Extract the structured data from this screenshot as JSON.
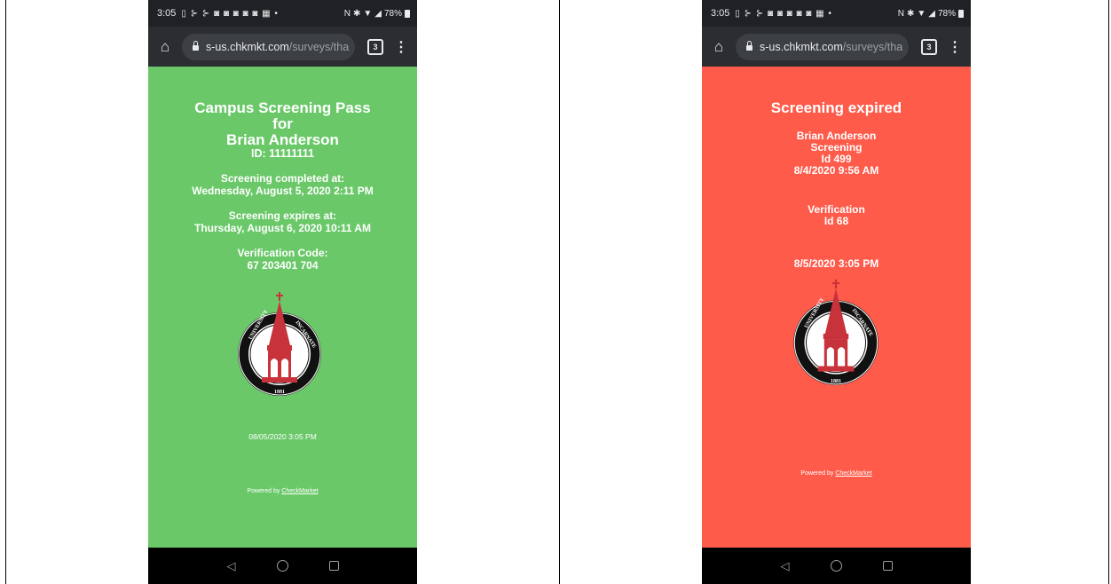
{
  "screens": [
    {
      "status_bar": {
        "time": "3:05",
        "notifications": "▯ ⊱ ⊱ ◙ ◙ ◙ ◙ ◙ ▦ •",
        "nfc": "N",
        "bluetooth": "✱",
        "battery": "78%"
      },
      "browser": {
        "url_domain": "s-us.chkmkt.com",
        "url_path": "/surveys/tha",
        "tab_count": "3"
      },
      "title_line1": "Campus Screening Pass",
      "title_line2": "for",
      "title_line3": "Brian Anderson",
      "id_line": "ID: 11111111",
      "completed_label": "Screening completed at:",
      "completed_value": "Wednesday, August 5, 2020 2:11 PM",
      "expires_label": "Screening expires at:",
      "expires_value": "Thursday, August 6, 2020 10:11 AM",
      "code_label": "Verification Code:",
      "code_value": "67 203401 704",
      "timestamp": "08/05/2020 3:05 PM",
      "powered_prefix": "Powered by ",
      "powered_link": "CheckMarket",
      "background_color": "#6ac869"
    },
    {
      "status_bar": {
        "time": "3:05",
        "notifications": "▯ ⊱ ⊱ ◙ ◙ ◙ ◙ ◙ ▦ •",
        "nfc": "N",
        "bluetooth": "✱",
        "battery": "78%"
      },
      "browser": {
        "url_domain": "s-us.chkmkt.com",
        "url_path": "/surveys/tha",
        "tab_count": "3"
      },
      "title": "Screening expired",
      "name": "Brian Anderson",
      "screening_label": "Screening",
      "screening_id": "Id 499",
      "screening_date": "8/4/2020 9:56 AM",
      "verification_label": "Verification",
      "verification_id": "Id 68",
      "timestamp": "8/5/2020 3:05 PM",
      "powered_prefix": "Powered by ",
      "powered_link": "CheckMarket",
      "background_color": "#fe5b4a"
    }
  ],
  "seal": {
    "text_top": "UNIVERSITY OF THE INCARNATE WORD",
    "year": "1881"
  }
}
